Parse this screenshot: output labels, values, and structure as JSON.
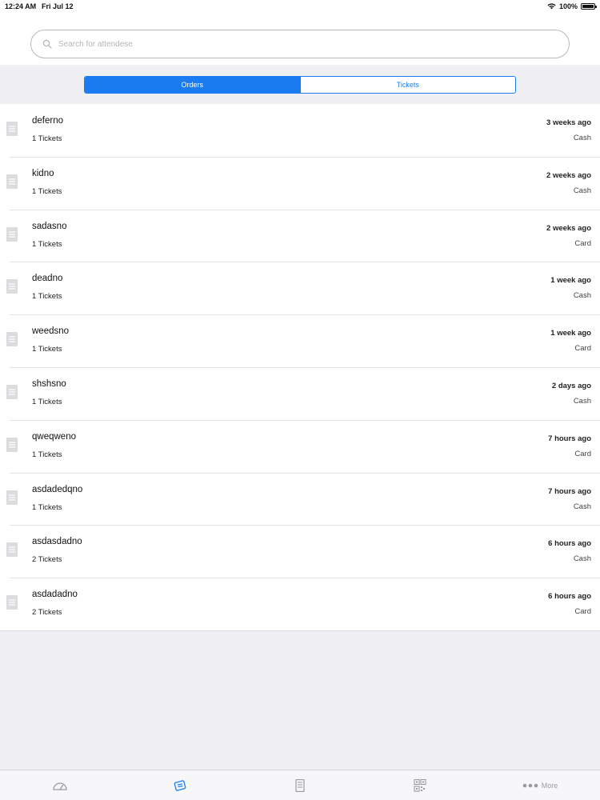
{
  "status_bar": {
    "time": "12:24 AM",
    "date": "Fri Jul 12",
    "battery": "100%"
  },
  "search": {
    "placeholder": "Search for attendese"
  },
  "segments": {
    "orders": "Orders",
    "tickets": "Tickets"
  },
  "orders": [
    {
      "name": "deferno",
      "tickets": "1 Tickets",
      "time": "3 weeks ago",
      "payment": "Cash"
    },
    {
      "name": "kidno",
      "tickets": "1 Tickets",
      "time": "2 weeks ago",
      "payment": "Cash"
    },
    {
      "name": "sadasno",
      "tickets": "1 Tickets",
      "time": "2 weeks ago",
      "payment": "Card"
    },
    {
      "name": "deadno",
      "tickets": "1 Tickets",
      "time": "1 week ago",
      "payment": "Cash"
    },
    {
      "name": "weedsno",
      "tickets": "1 Tickets",
      "time": "1 week ago",
      "payment": "Card"
    },
    {
      "name": "shshsno",
      "tickets": "1 Tickets",
      "time": "2 days ago",
      "payment": "Cash"
    },
    {
      "name": "qweqweno",
      "tickets": "1 Tickets",
      "time": "7 hours ago",
      "payment": "Card"
    },
    {
      "name": "asdadedqno",
      "tickets": "1 Tickets",
      "time": "7 hours ago",
      "payment": "Cash"
    },
    {
      "name": "asdasdadno",
      "tickets": "2 Tickets",
      "time": "6 hours ago",
      "payment": "Cash"
    },
    {
      "name": "asdadadno",
      "tickets": "2 Tickets",
      "time": "6 hours ago",
      "payment": "Card"
    }
  ],
  "tab_bar": {
    "more_label": "More",
    "icons": [
      "dashboard-icon",
      "tickets-icon",
      "orders-icon",
      "qr-scan-icon",
      "more-dots-icon"
    ],
    "active_color": "#1b7cf2",
    "inactive_color": "#9a9aa0"
  },
  "colors": {
    "accent": "#1b7cf2",
    "background": "#f0eff4"
  }
}
